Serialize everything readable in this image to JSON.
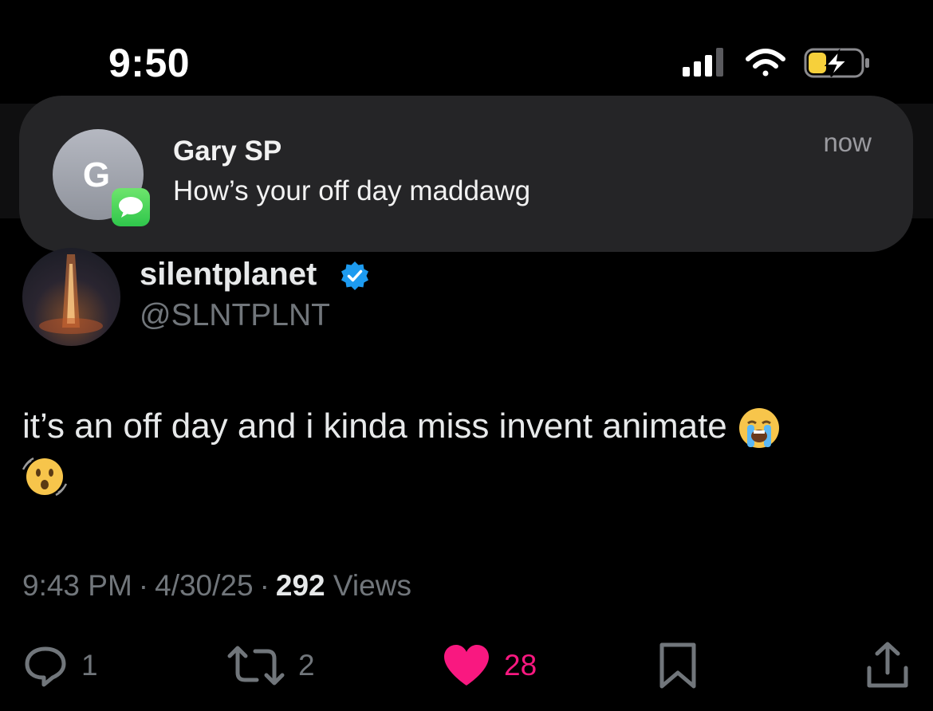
{
  "status_bar": {
    "time": "9:50",
    "icons": [
      "cellular-signal-icon",
      "wifi-icon",
      "battery-charging-icon"
    ]
  },
  "notification": {
    "sender": "Gary SP",
    "initial": "G",
    "message": "How’s your off day maddawg",
    "time": "now",
    "app_icon": "messages-icon"
  },
  "post": {
    "display_name": "silentplanet",
    "handle": "@SLNTPLNT",
    "verified": true,
    "text": "it’s an off day and i kinda miss invent animate",
    "emojis": [
      "loudly-crying-face-emoji",
      "shaking-face-emoji"
    ],
    "meta": {
      "time": "9:43 PM",
      "date": "4/30/25",
      "views_count": "292",
      "views_label": "Views"
    },
    "actions": {
      "replies": "1",
      "reposts": "2",
      "likes": "28"
    }
  },
  "colors": {
    "background": "#000000",
    "notification_bg": "#252527",
    "muted_text": "#71767b",
    "like": "#f91880",
    "verified": "#1d9bf0",
    "battery_charging": "#f6d03b"
  }
}
